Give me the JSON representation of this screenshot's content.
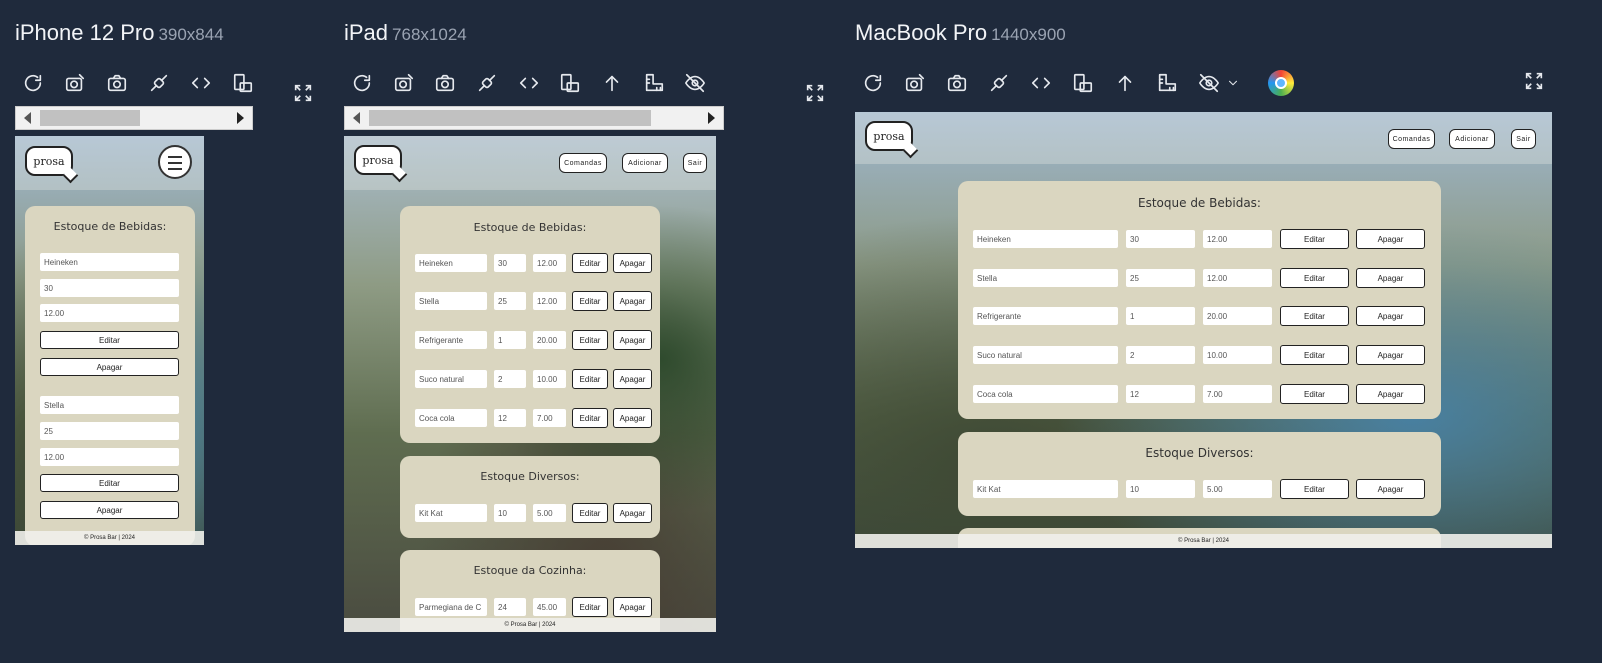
{
  "devices": {
    "iphone": {
      "name": "iPhone 12 Pro",
      "size": "390x844"
    },
    "ipad": {
      "name": "iPad",
      "size": "768x1024"
    },
    "macbook": {
      "name": "MacBook Pro",
      "size": "1440x900"
    }
  },
  "site": {
    "logo": "prosa",
    "nav": {
      "comandas": "Comandas",
      "adicionar": "Adicionar",
      "sair": "Sair"
    },
    "footer": "© Prosa Bar | 2024",
    "edit_label": "Editar",
    "delete_label": "Apagar"
  },
  "sections": {
    "bebidas": {
      "title": "Estoque de Bebidas:",
      "items": [
        {
          "name": "Heineken",
          "qty": "30",
          "price": "12.00"
        },
        {
          "name": "Stella",
          "qty": "25",
          "price": "12.00"
        },
        {
          "name": "Refrigerante",
          "qty": "1",
          "price": "20.00"
        },
        {
          "name": "Suco natural",
          "qty": "2",
          "price": "10.00"
        },
        {
          "name": "Coca cola",
          "qty": "12",
          "price": "7.00"
        }
      ]
    },
    "diversos": {
      "title": "Estoque Diversos:",
      "items": [
        {
          "name": "Kit Kat",
          "qty": "10",
          "price": "5.00"
        }
      ]
    },
    "cozinha": {
      "title": "Estoque da Cozinha:",
      "items": [
        {
          "name": "Parmegiana de C",
          "qty": "24",
          "price": "45.00"
        }
      ]
    }
  },
  "colors": {
    "app_bg": "#1f2a3c",
    "panel": "#dad6c0",
    "accent_text": "#9aa3b2"
  },
  "icons": [
    "refresh-icon",
    "screenshot-edit-icon",
    "camera-icon",
    "plug-icon",
    "code-icon",
    "rotate-device-icon",
    "upload-arrow-icon",
    "ruler-icon",
    "eye-off-icon",
    "chevron-down-icon",
    "chrome-icon",
    "expand-icon"
  ]
}
